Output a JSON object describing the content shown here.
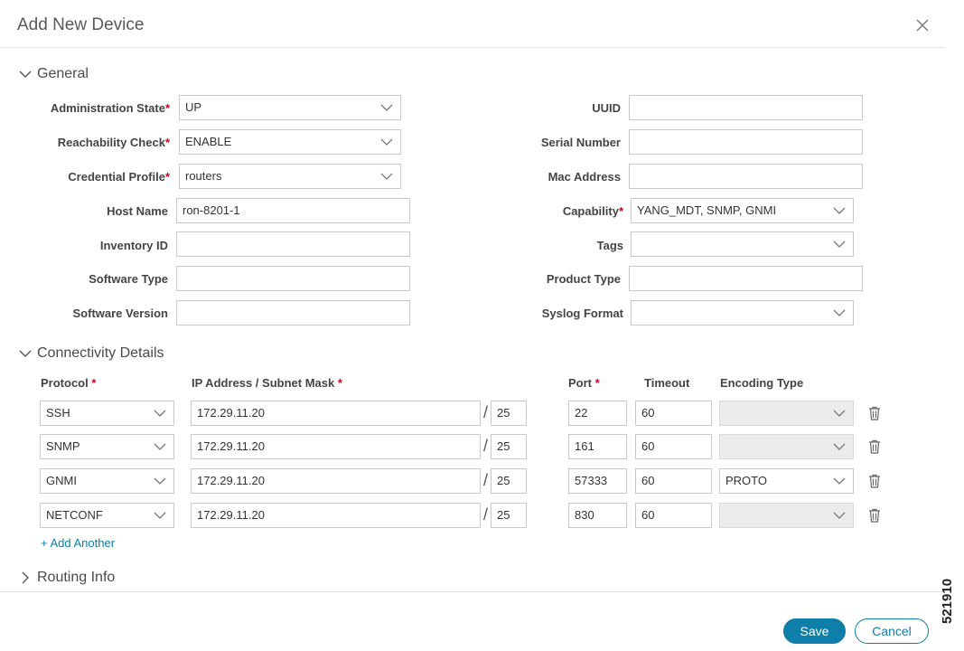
{
  "dialog": {
    "title": "Add New Device"
  },
  "general": {
    "header": "General",
    "admin_state": {
      "label": "Administration State",
      "required": "*",
      "value": "UP"
    },
    "reachability": {
      "label": "Reachability Check",
      "required": "*",
      "value": "ENABLE"
    },
    "credential": {
      "label": "Credential Profile",
      "required": "*",
      "value": "routers"
    },
    "host_name": {
      "label": "Host Name",
      "value": "ron-8201-1"
    },
    "inventory_id": {
      "label": "Inventory ID",
      "value": ""
    },
    "software_type": {
      "label": "Software Type",
      "value": ""
    },
    "software_version": {
      "label": "Software Version",
      "value": ""
    },
    "uuid": {
      "label": "UUID",
      "value": ""
    },
    "serial_number": {
      "label": "Serial Number",
      "value": ""
    },
    "mac_address": {
      "label": "Mac Address",
      "value": ""
    },
    "capability": {
      "label": "Capability",
      "required": "*",
      "value": "YANG_MDT, SNMP, GNMI"
    },
    "tags": {
      "label": "Tags",
      "value": ""
    },
    "product_type": {
      "label": "Product Type",
      "value": ""
    },
    "syslog_format": {
      "label": "Syslog Format",
      "value": ""
    }
  },
  "connectivity": {
    "header": "Connectivity Details",
    "columns": {
      "protocol": "Protocol",
      "ip": "IP Address / Subnet Mask",
      "port": "Port",
      "timeout": "Timeout",
      "encoding": "Encoding Type",
      "required": "*"
    },
    "slash": "/",
    "rows": [
      {
        "protocol": "SSH",
        "ip": "172.29.11.20",
        "mask": "25",
        "port": "22",
        "timeout": "60",
        "encoding": ""
      },
      {
        "protocol": "SNMP",
        "ip": "172.29.11.20",
        "mask": "25",
        "port": "161",
        "timeout": "60",
        "encoding": ""
      },
      {
        "protocol": "GNMI",
        "ip": "172.29.11.20",
        "mask": "25",
        "port": "57333",
        "timeout": "60",
        "encoding": "PROTO"
      },
      {
        "protocol": "NETCONF",
        "ip": "172.29.11.20",
        "mask": "25",
        "port": "830",
        "timeout": "60",
        "encoding": ""
      }
    ],
    "add_another": "+ Add Another"
  },
  "routing": {
    "header": "Routing Info"
  },
  "footer": {
    "save": "Save",
    "cancel": "Cancel"
  },
  "figure_number": "521910",
  "colors": {
    "accent": "#0d7fa8",
    "required": "#d0021b"
  }
}
